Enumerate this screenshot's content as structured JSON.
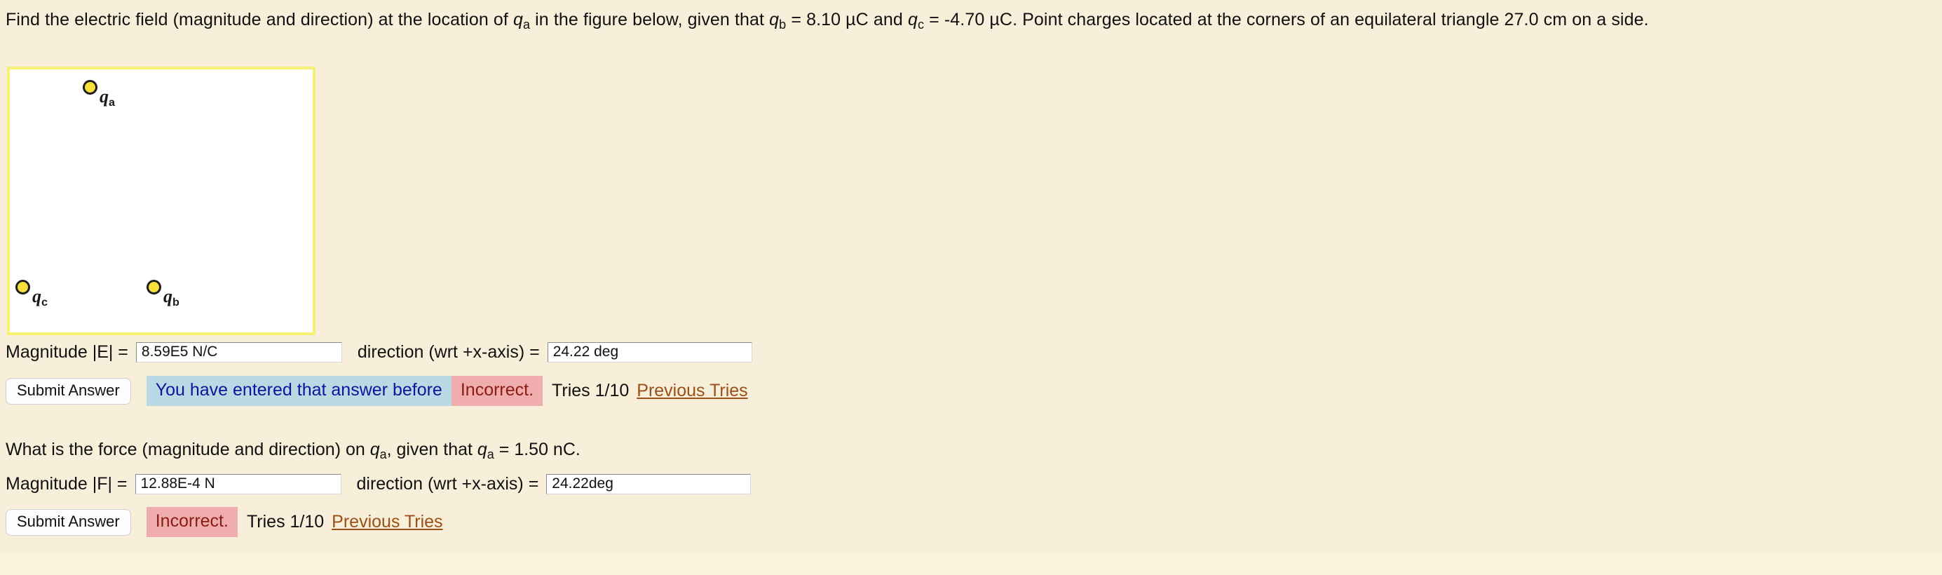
{
  "problem": {
    "statement_parts": [
      {
        "text": "Find the electric field (magnitude and direction) at the location of "
      },
      {
        "text": "q",
        "italic": true
      },
      {
        "text": "a",
        "sub": true
      },
      {
        "text": " in the figure below, given that "
      },
      {
        "text": "q",
        "italic": true
      },
      {
        "text": "b",
        "sub": true
      },
      {
        "text": " = 8.10 µC and "
      },
      {
        "text": "q",
        "italic": true
      },
      {
        "text": "c",
        "sub": true
      },
      {
        "text": " = -4.70 µC. Point charges located at the corners of an equilateral triangle 27.0 cm on a side."
      }
    ],
    "statement_line1": "Find the electric field (magnitude and direction) at the location of qa in the figure below, given that qb = 8.10 µC and qc = -4.70 µC. Point charges located at the corners of an equilateral triangle 27.0 cm on a",
    "statement_line2": "side.",
    "values": {
      "qb": "8.10 µC",
      "qc": "-4.70 µC",
      "side_length": "27.0 cm",
      "qa_force": "1.50 nC"
    }
  },
  "figure": {
    "border_color": "#f6f171",
    "background_color": "#ffffff",
    "charge_color": "#f7e03c",
    "charges": [
      {
        "id": "qa",
        "symbol": "q",
        "subscript": "a",
        "position": "top"
      },
      {
        "id": "qc",
        "symbol": "q",
        "subscript": "c",
        "position": "bottom-left"
      },
      {
        "id": "qb",
        "symbol": "q",
        "subscript": "b",
        "position": "bottom-right"
      }
    ]
  },
  "part_e": {
    "magnitude_label": "Magnitude |E|  = ",
    "magnitude_value": "8.59E5 N/C",
    "direction_label": "direction (wrt +x-axis)  = ",
    "direction_value": "24.22 deg",
    "submit_label": "Submit Answer",
    "message_entered_before": "You have entered that answer before",
    "message_incorrect": "Incorrect.",
    "tries": "Tries 1/10",
    "previous_tries_link": "Previous Tries"
  },
  "part_f": {
    "question_parts": [
      {
        "text": "What is the force (magnitude and direction) on "
      },
      {
        "text": "q",
        "italic": true
      },
      {
        "text": "a",
        "sub": true
      },
      {
        "text": ", given that "
      },
      {
        "text": "q",
        "italic": true
      },
      {
        "text": "a",
        "sub": true
      },
      {
        "text": " = 1.50 nC."
      }
    ],
    "question_text": "What is the force (magnitude and direction) on qa, given that qa = 1.50 nC.",
    "magnitude_label": "Magnitude |F|  = ",
    "magnitude_value": "12.88E-4 N",
    "direction_label": "direction (wrt +x-axis)  = ",
    "direction_value": "24.22deg",
    "submit_label": "Submit Answer",
    "message_incorrect": "Incorrect.",
    "tries": "Tries 1/10",
    "previous_tries_link": "Previous Tries"
  },
  "colors": {
    "page_background": "#f7efd9",
    "info_badge": "#b9d9e4",
    "info_text": "#10149a",
    "error_badge": "#efadad",
    "error_text": "#8d1b15",
    "link": "#9c4f17"
  }
}
